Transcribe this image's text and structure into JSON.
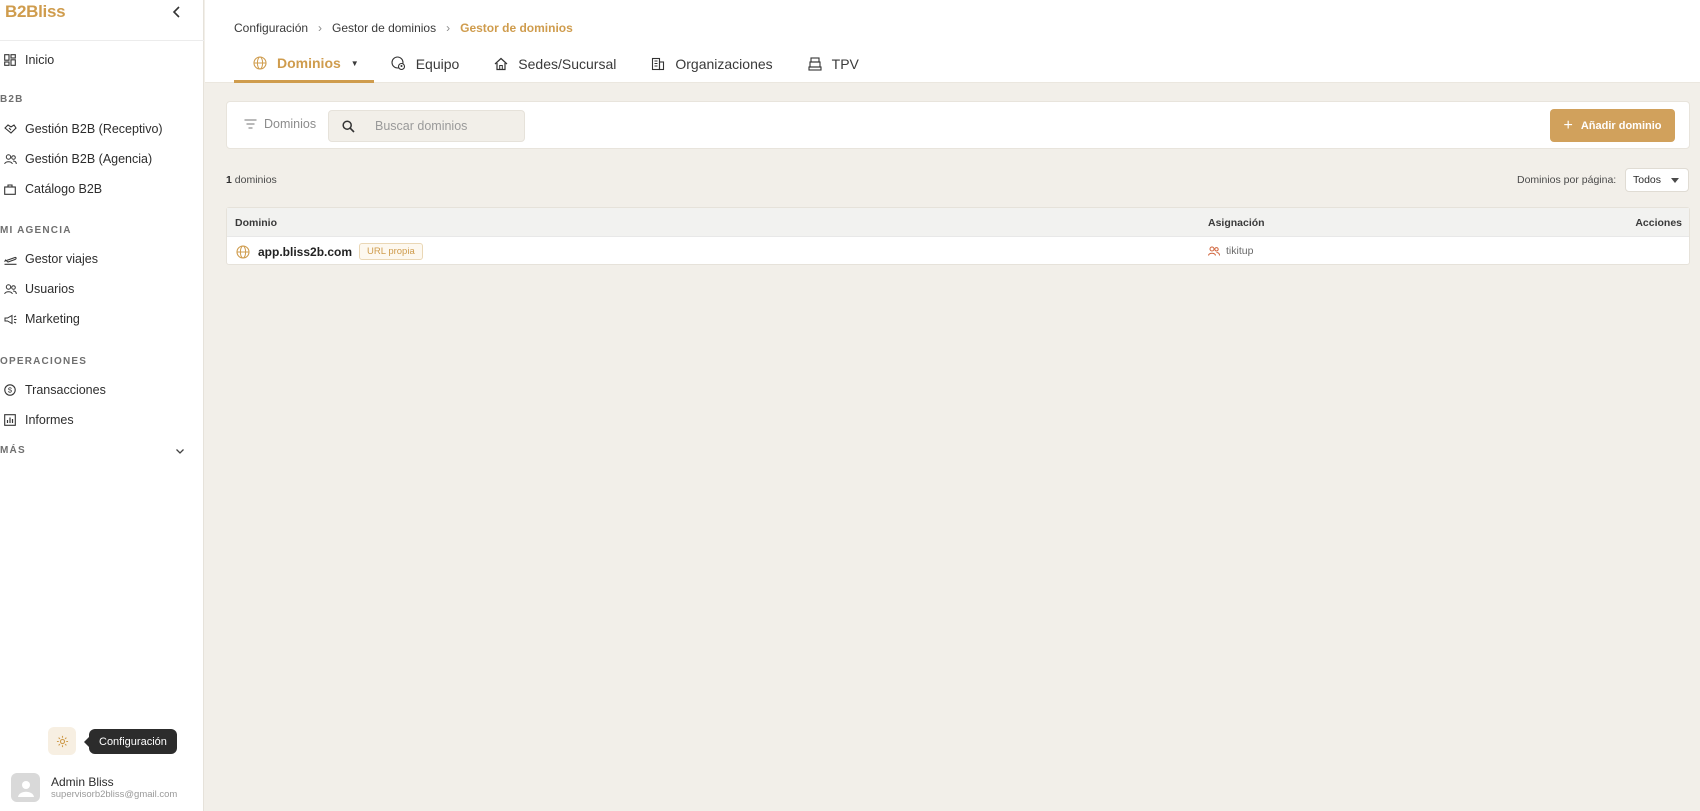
{
  "brand": "B2Bliss",
  "sidebar": {
    "home": "Inicio",
    "sections": {
      "b2b": "B2B",
      "agency": "MI AGENCIA",
      "operations": "OPERACIONES",
      "more": "MÁS"
    },
    "b2b_items": [
      "Gestión B2B (Receptivo)",
      "Gestión B2B (Agencia)",
      "Catálogo B2B"
    ],
    "agency_items": [
      "Gestor viajes",
      "Usuarios",
      "Marketing"
    ],
    "operations_items": [
      "Transacciones",
      "Informes"
    ],
    "settings_tooltip": "Configuración",
    "user": {
      "name": "Admin Bliss",
      "email": "supervisorb2bliss@gmail.com"
    }
  },
  "header": {
    "breadcrumb": [
      "Configuración",
      "Gestor de dominios",
      "Gestor de dominios"
    ],
    "tabs": [
      "Dominios",
      "Equipo",
      "Sedes/Sucursal",
      "Organizaciones",
      "TPV"
    ]
  },
  "toolbar": {
    "filter_label": "Dominios",
    "search_placeholder": "Buscar dominios",
    "add_label": "Añadir dominio"
  },
  "list": {
    "count": "1",
    "count_suffix": "dominios",
    "per_page_label": "Dominios por página:",
    "per_page_value": "Todos"
  },
  "table": {
    "headers": [
      "Dominio",
      "Asignación",
      "Acciones"
    ],
    "rows": [
      {
        "domain": "app.bliss2b.com",
        "badge": "URL propia",
        "assignment": "tikitup"
      }
    ]
  },
  "colors": {
    "accent": "#cf9c4d",
    "button": "#d1a15c",
    "background": "#f2efe9"
  }
}
